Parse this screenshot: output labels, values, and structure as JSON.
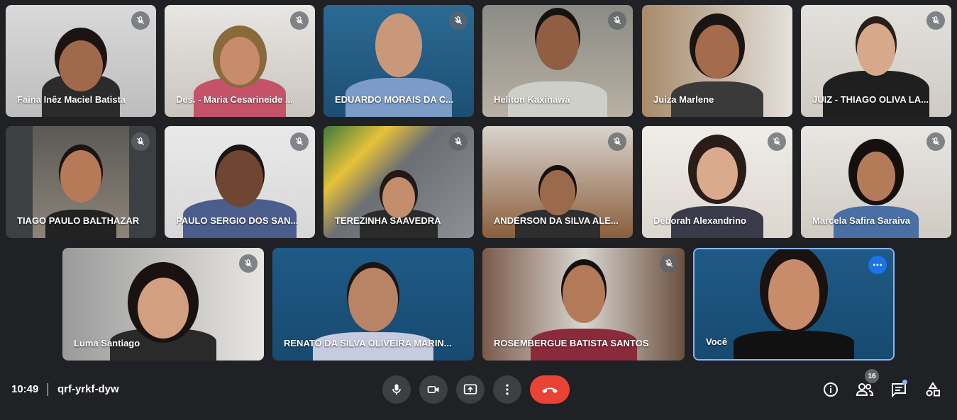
{
  "participants": [
    {
      "name": "Faina Inêz Maciel Batista",
      "muted": true
    },
    {
      "name": "Des. - Maria Cesarineide ...",
      "muted": true
    },
    {
      "name": "EDUARDO MORAIS DA C...",
      "muted": true
    },
    {
      "name": "Heliton Kaxinawá",
      "muted": true
    },
    {
      "name": "Juiza Marlene",
      "muted": false
    },
    {
      "name": "JUIZ - THIAGO OLIVA LA...",
      "muted": true
    },
    {
      "name": "TIAGO PAULO BALTHAZAR",
      "muted": true
    },
    {
      "name": "PAULO SERGIO DOS SAN...",
      "muted": true
    },
    {
      "name": "TEREZINHA SAAVEDRA",
      "muted": true
    },
    {
      "name": "ANDERSON DA SILVA ALE...",
      "muted": true
    },
    {
      "name": "Déborah Alexandrino",
      "muted": true
    },
    {
      "name": "Marcela Safira Saraiva",
      "muted": true
    },
    {
      "name": "Luma Santiago",
      "muted": true
    },
    {
      "name": "RENATO DA SILVA OLIVEIRA MARIN...",
      "muted": false
    },
    {
      "name": "ROSEMBERGUE BATISTA SANTOS",
      "muted": true
    },
    {
      "name": "Você",
      "muted": false,
      "self": true
    }
  ],
  "bottom_bar": {
    "time": "10:49",
    "meeting_code": "qrf-yrkf-dyw",
    "people_count": "16",
    "controls": [
      "mic-icon",
      "camera-icon",
      "present-screen-icon",
      "more-options-icon",
      "end-call-icon"
    ],
    "right_icons": [
      "info-icon",
      "people-icon",
      "chat-icon",
      "activities-icon"
    ]
  },
  "colors": {
    "background": "#202124",
    "control_bg": "#3c4043",
    "end_call": "#ea4335",
    "self_border": "#8ab4f8",
    "accent": "#1a73e8"
  }
}
